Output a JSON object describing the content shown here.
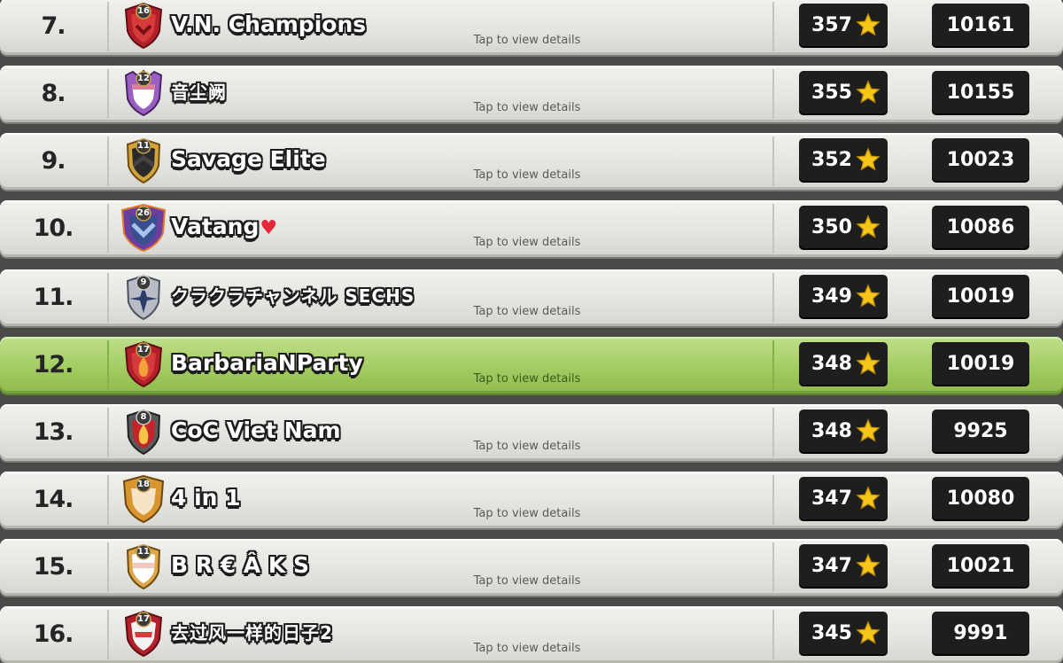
{
  "leaderboard": {
    "tap_hint": "Tap to view details",
    "colors": {
      "row_bg": "#e4e4e0",
      "highlight_bg": "#a3cc62",
      "value_box_bg": "#1e1e1e",
      "star": "#f5c518"
    },
    "rows": [
      {
        "rank": "7.",
        "clan_name": "V.N. Champions",
        "badge_level": "16",
        "badge_icon": "clan-badge-red-shield",
        "stars": "357",
        "trophies": "10161"
      },
      {
        "rank": "8.",
        "clan_name": "音尘阙",
        "badge_level": "12",
        "badge_icon": "clan-badge-purple-crown",
        "stars": "355",
        "trophies": "10155"
      },
      {
        "rank": "9.",
        "clan_name": "Savage Elite",
        "badge_level": "11",
        "badge_icon": "clan-badge-black-gold",
        "stars": "352",
        "trophies": "10023"
      },
      {
        "rank": "10.",
        "clan_name": "Vatang",
        "badge_level": "26",
        "badge_icon": "clan-badge-blue-chevron",
        "stars": "350",
        "trophies": "10086",
        "name_suffix_icon": "heart-icon"
      },
      {
        "rank": "11.",
        "clan_name": "クラクラチャンネル SECHS",
        "badge_level": "9",
        "badge_icon": "clan-badge-grey-star",
        "stars": "349",
        "trophies": "10019"
      },
      {
        "rank": "12.",
        "clan_name": "BarbariaNParty",
        "badge_level": "17",
        "badge_icon": "clan-badge-red-flame",
        "stars": "348",
        "trophies": "10019",
        "highlighted": true
      },
      {
        "rank": "13.",
        "clan_name": "CoC Viet Nam",
        "badge_level": "8",
        "badge_icon": "clan-badge-dark-flame",
        "stars": "348",
        "trophies": "9925"
      },
      {
        "rank": "14.",
        "clan_name": "4 in 1",
        "badge_level": "18",
        "badge_icon": "clan-badge-gold-frame",
        "stars": "347",
        "trophies": "10080"
      },
      {
        "rank": "15.",
        "clan_name": "B R € Â K S",
        "badge_level": "11",
        "badge_icon": "clan-badge-white-gold",
        "stars": "347",
        "trophies": "10021"
      },
      {
        "rank": "16.",
        "clan_name": "去过风一样的日子2",
        "badge_level": "17",
        "badge_icon": "clan-badge-red-white",
        "stars": "345",
        "trophies": "9991"
      }
    ]
  }
}
